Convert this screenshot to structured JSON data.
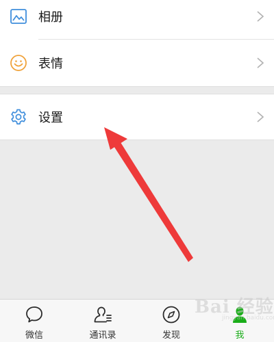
{
  "menu": {
    "album_label": "相册",
    "sticker_label": "表情",
    "settings_label": "设置"
  },
  "tabbar": {
    "chats_label": "微信",
    "contacts_label": "通讯录",
    "discover_label": "发现",
    "me_label": "我",
    "active_tab": "me"
  },
  "watermark": {
    "text": "Bai 经验",
    "sub": "jingyan.baidu.com"
  },
  "icons": {
    "album": "picture-icon",
    "sticker": "smiley-icon",
    "settings": "gear-icon",
    "chevron": "chevron-right-icon",
    "chats": "chat-bubble-icon",
    "contacts": "contacts-icon",
    "discover": "compass-icon",
    "me": "person-icon"
  },
  "colors": {
    "accent_green": "#1aad19",
    "annotation_arrow": "#ee3a3a",
    "album_icon": "#3f8edc",
    "sticker_icon": "#f0a23a",
    "settings_icon": "#3f8edc",
    "chevron": "#b2b2b2",
    "background": "#ebebeb"
  }
}
